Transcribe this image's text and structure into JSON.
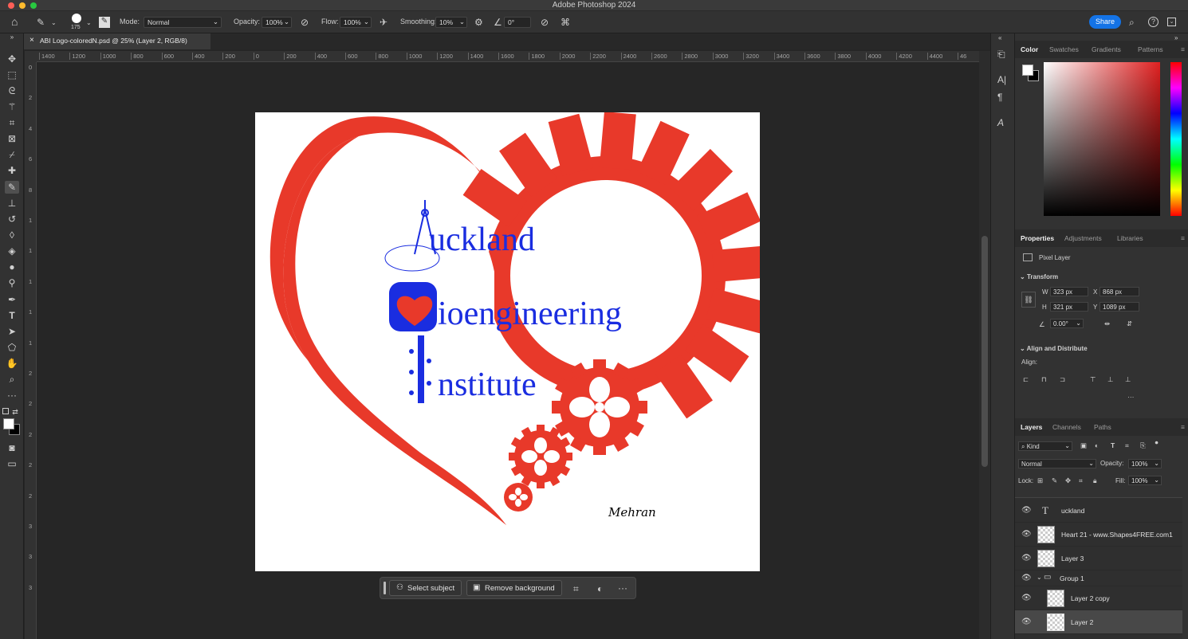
{
  "window": {
    "title": "Adobe Photoshop 2024",
    "traffic_colors": [
      "#ff5f57",
      "#febc2e",
      "#28c840"
    ]
  },
  "options_bar": {
    "brush_size": "175",
    "mode_label": "Mode:",
    "mode_value": "Normal",
    "opacity_label": "Opacity:",
    "opacity_value": "100%",
    "flow_label": "Flow:",
    "flow_value": "100%",
    "smoothing_label": "Smoothing:",
    "smoothing_value": "10%",
    "angle_value": "0°",
    "share_label": "Share",
    "share_color": "#1473e6"
  },
  "document_tab": {
    "close": "×",
    "label": "ABI Logo-coloredN.psd @ 25% (Layer 2, RGB/8)"
  },
  "ruler_h": [
    "1400",
    "1200",
    "1000",
    "800",
    "600",
    "400",
    "200",
    "0",
    "200",
    "400",
    "600",
    "800",
    "1000",
    "1200",
    "1400",
    "1600",
    "1800",
    "2000",
    "2200",
    "2400",
    "2600",
    "2800",
    "3000",
    "3200",
    "3400",
    "3600",
    "3800",
    "4000",
    "4200",
    "4400",
    "46"
  ],
  "ruler_v": [
    "0",
    "2",
    "4",
    "6",
    "8",
    "1",
    "1",
    "1",
    "1",
    "1",
    "2",
    "2",
    "2",
    "2",
    "2",
    "3",
    "3",
    "3"
  ],
  "artwork": {
    "line1": "uckland",
    "line2": "ioengineering",
    "line3": "nstitute",
    "signature": "Mehran",
    "red": "#e8392a",
    "blue": "#1a2de0"
  },
  "context_bar": {
    "select_subject": "Select subject",
    "remove_background": "Remove background",
    "more": "···"
  },
  "color_panel": {
    "tabs": [
      "Color",
      "Swatches",
      "Gradients",
      "Patterns"
    ],
    "active": "Color",
    "base_hue": "#e02020"
  },
  "properties_panel": {
    "tabs": [
      "Properties",
      "Adjustments",
      "Libraries"
    ],
    "active": "Properties",
    "layer_type": "Pixel Layer",
    "transform_title": "Transform",
    "w_label": "W",
    "w_value": "323 px",
    "x_label": "X",
    "x_value": "868 px",
    "h_label": "H",
    "h_value": "321 px",
    "y_label": "Y",
    "y_value": "1089 px",
    "angle_value": "0.00°",
    "align_title": "Align and Distribute",
    "align_label": "Align:",
    "more": "···"
  },
  "layers_panel": {
    "tabs": [
      "Layers",
      "Channels",
      "Paths"
    ],
    "active": "Layers",
    "filter_kind": "Kind",
    "blend_mode": "Normal",
    "opacity_label": "Opacity:",
    "opacity_value": "100%",
    "lock_label": "Lock:",
    "fill_label": "Fill:",
    "fill_value": "100%",
    "layers": [
      {
        "name": "uckland",
        "kind": "text"
      },
      {
        "name": "Heart 21 - www.Shapes4FREE.com1",
        "kind": "pixel"
      },
      {
        "name": "Layer 3",
        "kind": "pixel"
      },
      {
        "name": "Group 1",
        "kind": "group"
      },
      {
        "name": "Layer 2 copy",
        "kind": "pixel"
      },
      {
        "name": "Layer 2",
        "kind": "pixel",
        "selected": true
      }
    ]
  }
}
